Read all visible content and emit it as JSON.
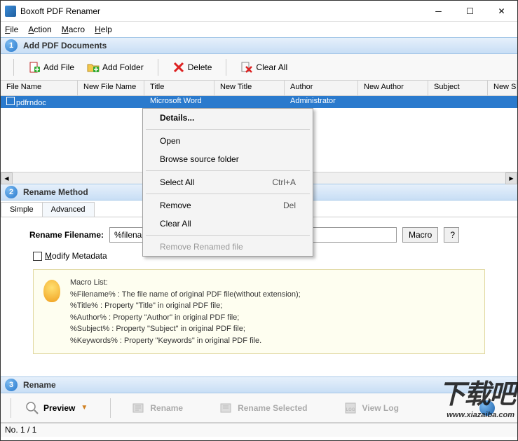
{
  "window": {
    "title": "Boxoft PDF Renamer"
  },
  "menu": {
    "file": "File",
    "action": "Action",
    "macro": "Macro",
    "help": "Help"
  },
  "sections": {
    "s1": {
      "num": "1",
      "label": "Add PDF Documents"
    },
    "s2": {
      "num": "2",
      "label": "Rename Method"
    },
    "s3": {
      "num": "3",
      "label": "Rename"
    }
  },
  "toolbar": {
    "add_file": "Add File",
    "add_folder": "Add Folder",
    "delete": "Delete",
    "clear_all": "Clear All"
  },
  "table": {
    "headers": {
      "file_name": "File Name",
      "new_file_name": "New File Name",
      "title": "Title",
      "new_title": "New Title",
      "author": "Author",
      "new_author": "New Author",
      "subject": "Subject",
      "new_subject": "New S"
    },
    "row": {
      "file_name": "pdfrndoc",
      "new_file_name": "",
      "title": "Microsoft Word",
      "new_title": "",
      "author": "Administrator",
      "new_author": "",
      "subject": ""
    }
  },
  "contextmenu": {
    "details": "Details...",
    "open": "Open",
    "browse": "Browse source folder",
    "select_all": "Select All",
    "select_all_shortcut": "Ctrl+A",
    "remove": "Remove",
    "remove_shortcut": "Del",
    "clear_all": "Clear All",
    "remove_renamed": "Remove Renamed file"
  },
  "tabs": {
    "simple": "Simple",
    "advanced": "Advanced"
  },
  "form": {
    "rename_label": "Rename Filename:",
    "rename_value": "%filename%",
    "macro_btn": "Macro",
    "help_btn": "?",
    "modify_metadata": "Modify Metadata"
  },
  "macro_info": {
    "header": "Macro List:",
    "l1": "%Filename%  : The file name of original PDF file(without extension);",
    "l2": "%Title%    : Property \"Title\" in original PDF file;",
    "l3": "%Author%   : Property \"Author\" in original PDF file;",
    "l4": "%Subject%  : Property \"Subject\" in original PDF file;",
    "l5": "%Keywords%  : Property \"Keywords\" in original PDF file."
  },
  "bottom": {
    "preview": "Preview",
    "rename": "Rename",
    "rename_selected": "Rename Selected",
    "view_log": "View Log"
  },
  "status": {
    "text": "No. 1 / 1"
  },
  "watermark": {
    "big": "下载吧",
    "url": "www.xiazaiba.com"
  }
}
